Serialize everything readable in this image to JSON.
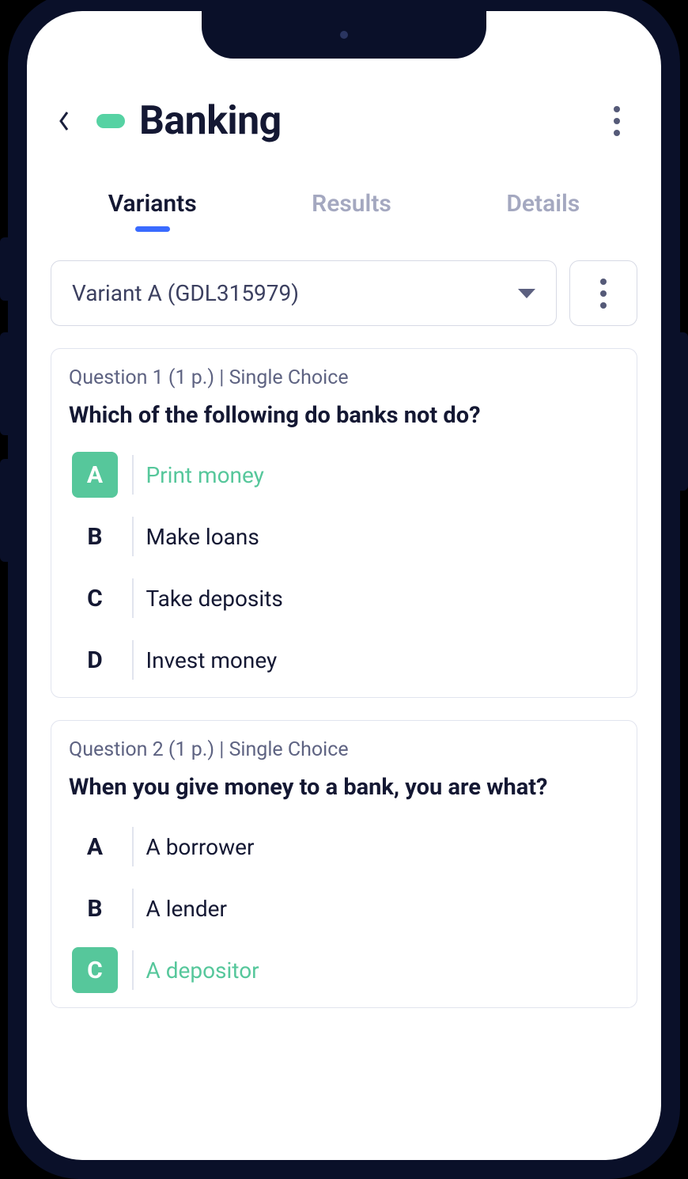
{
  "header": {
    "title": "Banking"
  },
  "tabs": [
    {
      "label": "Variants",
      "active": true
    },
    {
      "label": "Results",
      "active": false
    },
    {
      "label": "Details",
      "active": false
    }
  ],
  "variant_selector": {
    "selected": "Variant A (GDL315979)"
  },
  "questions": [
    {
      "meta": "Question 1  (1 p.)   |   Single Choice",
      "text": "Which of the following do banks not do?",
      "options": [
        {
          "letter": "A",
          "text": "Print money",
          "correct": true
        },
        {
          "letter": "B",
          "text": "Make loans",
          "correct": false
        },
        {
          "letter": "C",
          "text": "Take deposits",
          "correct": false
        },
        {
          "letter": "D",
          "text": "Invest money",
          "correct": false
        }
      ]
    },
    {
      "meta": "Question 2  (1 p.)   |   Single Choice",
      "text": "When you give money to a bank, you are what?",
      "options": [
        {
          "letter": "A",
          "text": "A borrower",
          "correct": false
        },
        {
          "letter": "B",
          "text": "A lender",
          "correct": false
        },
        {
          "letter": "C",
          "text": "A depositor",
          "correct": true
        }
      ]
    }
  ]
}
